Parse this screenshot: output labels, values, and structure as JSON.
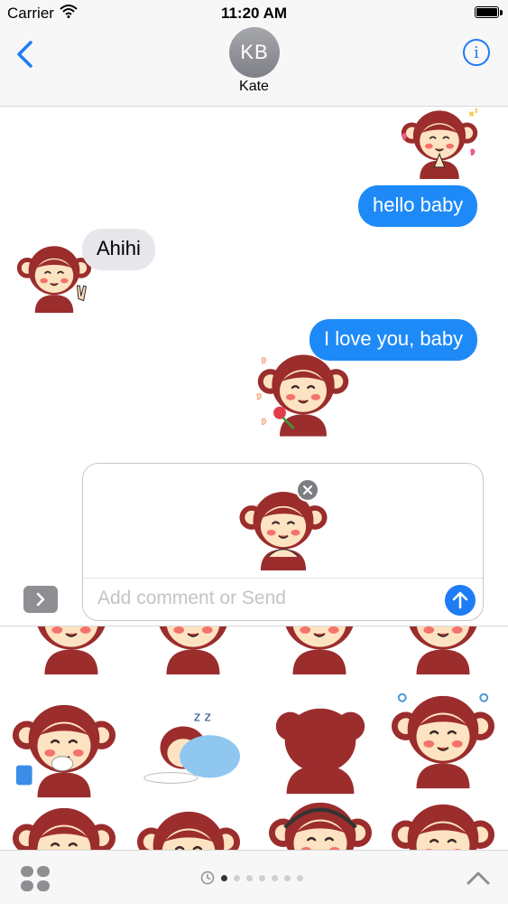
{
  "status": {
    "carrier": "Carrier",
    "time": "11:20 AM"
  },
  "nav": {
    "avatar_initials": "KB",
    "contact_name": "Kate"
  },
  "messages": [
    {
      "from": "me",
      "text": "hello baby"
    },
    {
      "from": "them",
      "text": "Ahihi"
    },
    {
      "from": "me",
      "text": "I love you, baby"
    }
  ],
  "compose": {
    "placeholder": "Add comment or Send"
  },
  "pager": {
    "pages": 7,
    "active": 1
  },
  "colors": {
    "accent": "#1e7cf5",
    "monkey_fur": "#9b2d2d",
    "skin": "#fde3c1",
    "bubble_in": "#e6e6eb"
  },
  "icons": [
    "back-chevron-icon",
    "info-icon",
    "close-icon",
    "send-arrow-icon",
    "expand-chevron-icon",
    "app-drawer-icon",
    "recent-clock-icon",
    "chevron-up-icon",
    "wifi-icon",
    "battery-icon"
  ]
}
